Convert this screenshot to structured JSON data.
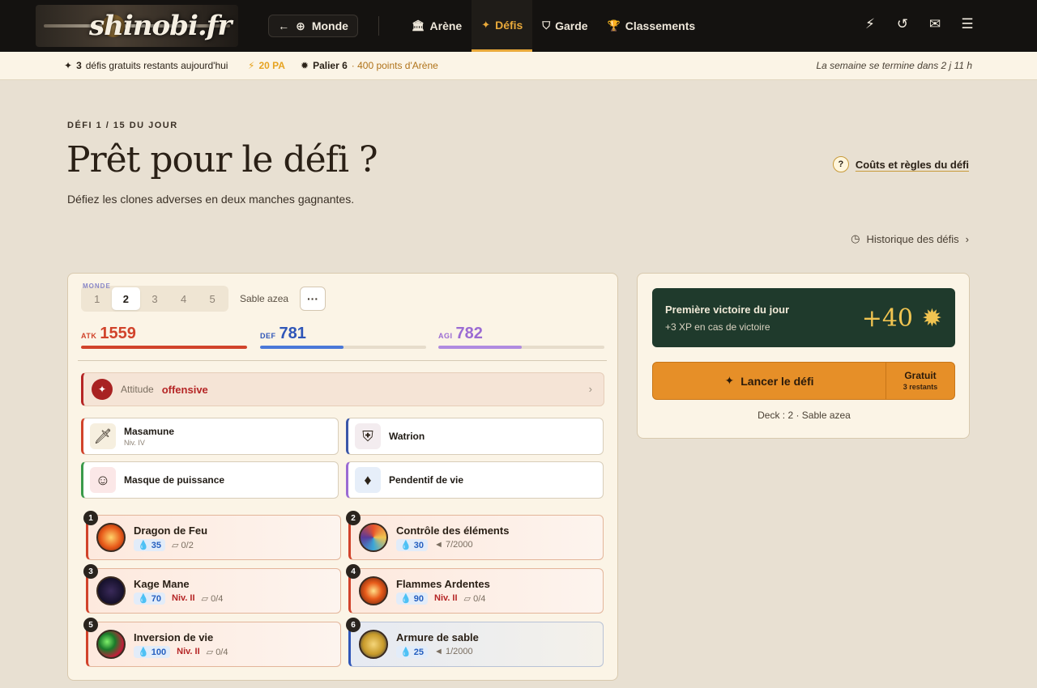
{
  "header": {
    "logo_text": "shinobi.fr",
    "world_button": "Monde",
    "nav": [
      {
        "label": "Arène",
        "icon": "building-icon"
      },
      {
        "label": "Défis",
        "icon": "swords-icon",
        "active": true
      },
      {
        "label": "Garde",
        "icon": "shield-icon"
      },
      {
        "label": "Classements",
        "icon": "trophy-icon"
      }
    ]
  },
  "subbar": {
    "free_count": "3",
    "free_text": "défis gratuits restants aujourd'hui",
    "pa": "20 PA",
    "palier": "Palier 6",
    "palier_points": "· 400 points d'Arène",
    "week_end": "La semaine se termine dans 2 j 11 h"
  },
  "page": {
    "eyebrow": "DÉFI 1 / 15 DU JOUR",
    "title": "Prêt pour le défi ?",
    "subtitle": "Défiez les clones adverses en deux manches gagnantes.",
    "rules_link": "Coûts et règles du défi",
    "history_link": "Historique des défis"
  },
  "deck": {
    "monde_tag": "MONDE",
    "tabs": [
      "1",
      "2",
      "3",
      "4",
      "5"
    ],
    "active_tab": 1,
    "name": "Sable azea",
    "more": "···",
    "stats": {
      "atk": {
        "label": "ATK",
        "value": "1559",
        "fill": 1.0,
        "color": "#d1432b"
      },
      "def": {
        "label": "DEF",
        "value": "781",
        "fill": 0.5,
        "color": "#4a78d8"
      },
      "agi": {
        "label": "AGI",
        "value": "782",
        "fill": 0.5,
        "color": "#b08be0"
      }
    },
    "attitude": {
      "label": "Attitude",
      "value": "offensive"
    },
    "equipment": [
      {
        "name": "Masamune",
        "level": "Niv. IV",
        "accent": "#d1432b"
      },
      {
        "name": "Watrion",
        "level": "",
        "accent": "#3a56a8"
      },
      {
        "name": "Masque de puissance",
        "level": "",
        "accent": "#3a9a4a"
      },
      {
        "name": "Pendentif de vie",
        "level": "",
        "accent": "#9b6bd3"
      }
    ],
    "skills": [
      {
        "num": "1",
        "name": "Dragon de Feu",
        "chakra": "35",
        "niv": "",
        "uses": "0/2"
      },
      {
        "num": "2",
        "name": "Contrôle des éléments",
        "chakra": "30",
        "niv": "",
        "uses": "7/2000"
      },
      {
        "num": "3",
        "name": "Kage Mane",
        "chakra": "70",
        "niv": "Niv. II",
        "uses": "0/4"
      },
      {
        "num": "4",
        "name": "Flammes Ardentes",
        "chakra": "90",
        "niv": "Niv. II",
        "uses": "0/4"
      },
      {
        "num": "5",
        "name": "Inversion de vie",
        "chakra": "100",
        "niv": "Niv. II",
        "uses": "0/4"
      },
      {
        "num": "6",
        "name": "Armure de sable",
        "chakra": "25",
        "niv": "",
        "uses": "1/2000"
      }
    ]
  },
  "right": {
    "bonus_title": "Première victoire du jour",
    "bonus_sub": "+3 XP en cas de victoire",
    "bonus_value": "+40",
    "launch": "Lancer le défi",
    "free": "Gratuit",
    "remaining": "3 restants",
    "deck_info": "Deck : 2 · Sable azea"
  }
}
